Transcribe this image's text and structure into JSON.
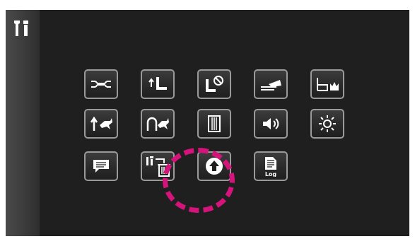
{
  "sidebar": {
    "icon": "settings-tools-icon"
  },
  "grid": {
    "rows": [
      [
        "thread-tension-icon",
        "presser-foot-up-icon",
        "presser-foot-sensor-off-icon",
        "bobbin-winding-icon",
        "needle-thread-icon"
      ],
      [
        "speed-up-icon",
        "knee-lifter-speed-icon",
        "stitch-width-icon",
        "volume-icon",
        "brightness-icon"
      ],
      [
        "message-icon",
        "reset-settings-icon",
        "update-icon",
        "log-icon"
      ]
    ]
  },
  "log_label": "Log",
  "colors": {
    "highlight": "#d4147a",
    "tile_border": "#9a9a9a",
    "icon": "#ffffff"
  }
}
